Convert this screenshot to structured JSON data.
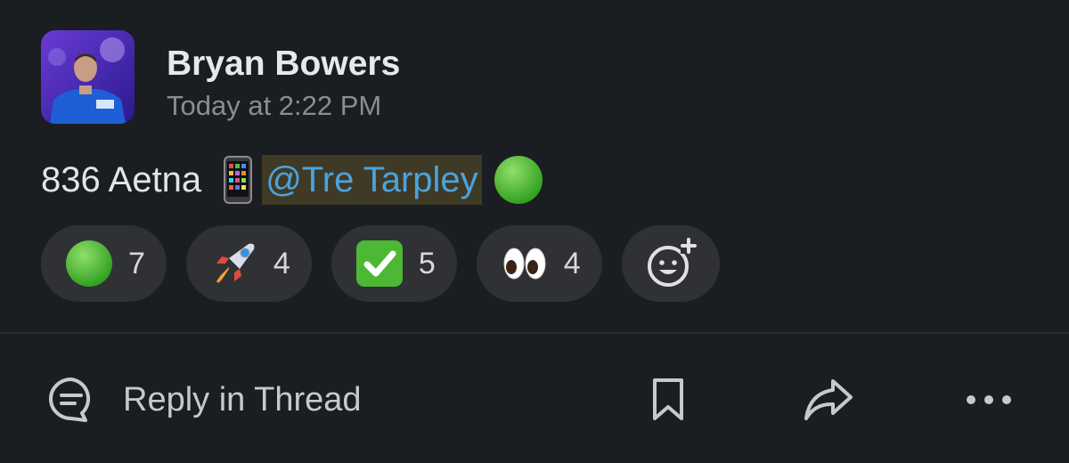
{
  "message": {
    "author": "Bryan Bowers",
    "timestamp": "Today at 2:22 PM",
    "text": "836 Aetna",
    "mention": "@Tre Tarpley",
    "inline_icons": [
      "mobile-phone-icon",
      "green-circle-icon"
    ]
  },
  "reactions": [
    {
      "icon": "green-circle-icon",
      "count": "7"
    },
    {
      "icon": "rocket-icon",
      "count": "4"
    },
    {
      "icon": "check-mark-icon",
      "count": "5"
    },
    {
      "icon": "eyes-icon",
      "count": "4"
    }
  ],
  "add_reaction": {
    "icon": "add-reaction-icon"
  },
  "actions": {
    "reply_label": "Reply in Thread",
    "reply_icon": "thread-bubble-icon",
    "bookmark_icon": "bookmark-icon",
    "share_icon": "share-icon",
    "more_icon": "more-icon"
  },
  "colors": {
    "background": "#1a1d21",
    "mention_text": "#4aa3df",
    "mention_bg": "#3f3a26",
    "pill_bg": "#2f3135"
  }
}
